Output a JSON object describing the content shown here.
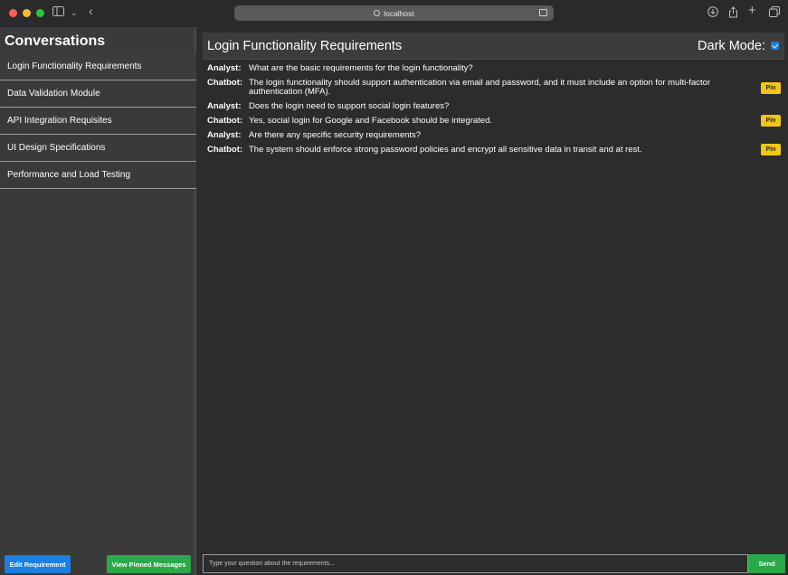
{
  "browser": {
    "url": "localhost"
  },
  "sidebar": {
    "title": "Conversations",
    "items": [
      {
        "label": "Login Functionality Requirements"
      },
      {
        "label": "Data Validation Module"
      },
      {
        "label": "API Integration Requisites"
      },
      {
        "label": "UI Design Specifications"
      },
      {
        "label": "Performance and Load Testing"
      }
    ],
    "edit_button": "Edit Requirement",
    "pinned_button": "View Pinned Messages"
  },
  "main": {
    "title": "Login Functionality Requirements",
    "dark_mode_label": "Dark Mode:",
    "dark_mode_checked": true,
    "messages": [
      {
        "who": "Analyst:",
        "text": "What are the basic requirements for the login functionality?"
      },
      {
        "who": "Chatbot:",
        "text": "The login functionality should support authentication via email and password, and it must include an option for multi-factor authentication (MFA).",
        "pin": "Pin"
      },
      {
        "who": "Analyst:",
        "text": "Does the login need to support social login features?"
      },
      {
        "who": "Chatbot:",
        "text": "Yes, social login for Google and Facebook should be integrated.",
        "pin": "Pin"
      },
      {
        "who": "Analyst:",
        "text": "Are there any specific security requirements?"
      },
      {
        "who": "Chatbot:",
        "text": "The system should enforce strong password policies and encrypt all sensitive data in transit and at rest.",
        "pin": "Pin"
      }
    ],
    "input_placeholder": "Type your question about the requirements...",
    "send_label": "Send"
  },
  "colors": {
    "primary_button": "#1a7fe0",
    "success_button": "#2aa84a",
    "pin_button": "#f5c518"
  }
}
